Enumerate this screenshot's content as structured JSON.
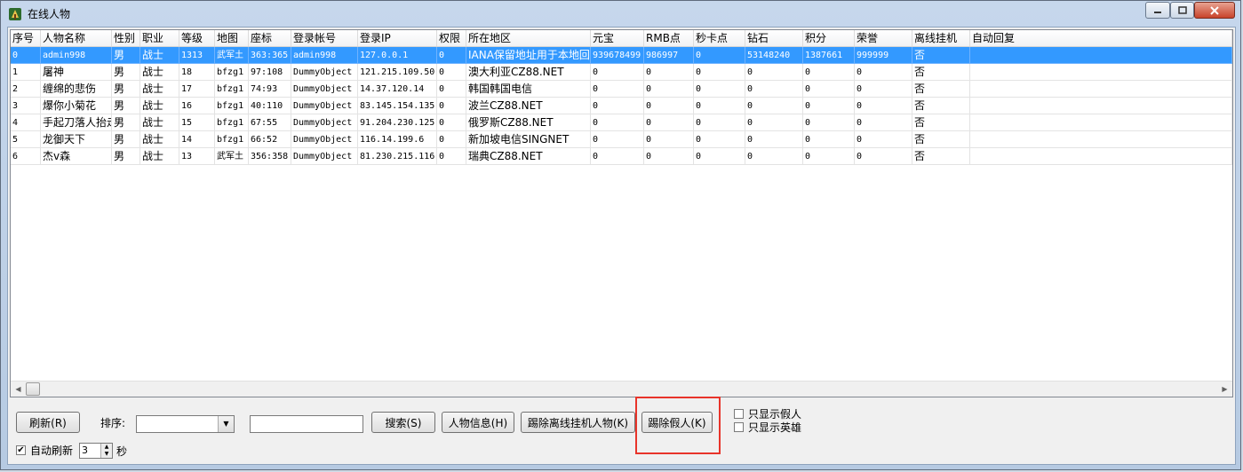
{
  "window": {
    "title": "在线人物",
    "icon": "game-app-icon"
  },
  "columns": [
    "序号",
    "人物名称",
    "性别",
    "职业",
    "等级",
    "地图",
    "座标",
    "登录帐号",
    "登录IP",
    "权限",
    "所在地区",
    "元宝",
    "RMB点",
    "秒卡点",
    "钻石",
    "积分",
    "荣誉",
    "离线挂机",
    "自动回复"
  ],
  "rows": [
    [
      "0",
      "admin998",
      "男",
      "战士",
      "1313",
      "武军土",
      "363:365",
      "admin998",
      "127.0.0.1",
      "0",
      "IANA保留地址用于本地回送",
      "939678499",
      "986997",
      "0",
      "53148240",
      "1387661",
      "999999",
      "否",
      ""
    ],
    [
      "1",
      "屠神",
      "男",
      "战士",
      "18",
      "bfzg1",
      "97:108",
      "DummyObject",
      "121.215.109.50",
      "0",
      "澳大利亚CZ88.NET",
      "0",
      "0",
      "0",
      "0",
      "0",
      "0",
      "否",
      ""
    ],
    [
      "2",
      "缠绵的悲伤",
      "男",
      "战士",
      "17",
      "bfzg1",
      "74:93",
      "DummyObject",
      "14.37.120.14",
      "0",
      "韩国韩国电信",
      "0",
      "0",
      "0",
      "0",
      "0",
      "0",
      "否",
      ""
    ],
    [
      "3",
      "爆你小菊花",
      "男",
      "战士",
      "16",
      "bfzg1",
      "40:110",
      "DummyObject",
      "83.145.154.135",
      "0",
      "波兰CZ88.NET",
      "0",
      "0",
      "0",
      "0",
      "0",
      "0",
      "否",
      ""
    ],
    [
      "4",
      "手起刀落人抬走",
      "男",
      "战士",
      "15",
      "bfzg1",
      "67:55",
      "DummyObject",
      "91.204.230.125",
      "0",
      "俄罗斯CZ88.NET",
      "0",
      "0",
      "0",
      "0",
      "0",
      "0",
      "否",
      ""
    ],
    [
      "5",
      "龙御天下",
      "男",
      "战士",
      "14",
      "bfzg1",
      "66:52",
      "DummyObject",
      "116.14.199.6",
      "0",
      "新加坡电信SINGNET",
      "0",
      "0",
      "0",
      "0",
      "0",
      "0",
      "否",
      ""
    ],
    [
      "6",
      "杰v森",
      "男",
      "战士",
      "13",
      "武军土",
      "356:358",
      "DummyObject",
      "81.230.215.116",
      "0",
      "瑞典CZ88.NET",
      "0",
      "0",
      "0",
      "0",
      "0",
      "0",
      "否",
      ""
    ]
  ],
  "selected_row": 0,
  "controls": {
    "refresh": "刷新(R)",
    "sort_label": "排序:",
    "sort_value": "",
    "search_value": "",
    "search": "搜索(S)",
    "char_info": "人物信息(H)",
    "kick_offline": "踢除离线挂机人物(K)",
    "kick_fake": "踢除假人(K)",
    "only_fake": "只显示假人",
    "only_hero": "只显示英雄",
    "auto_refresh": "自动刷新",
    "auto_refresh_checked": true,
    "interval": "3",
    "seconds": "秒"
  },
  "colors": {
    "selection": "#3399ff",
    "highlight_box": "#e8342a",
    "title_bar": "#b9cde6"
  }
}
